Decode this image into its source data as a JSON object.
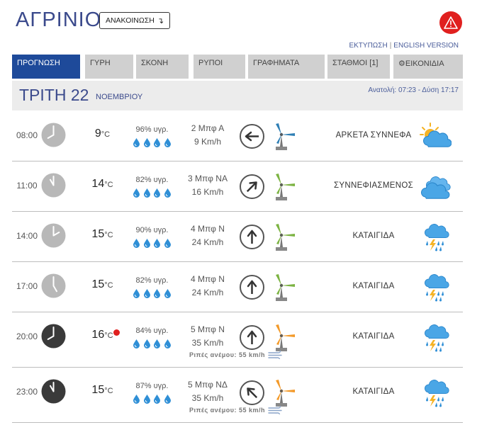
{
  "header": {
    "city": "ΑΓΡΙΝΙΟ",
    "announce_label": "ΑΝΑΚΟΙΝΩΣΗ",
    "announce_arrow": "↴",
    "print_link": "ΕΚΤΥΠΩΣΗ",
    "link_sep": "|",
    "english_link": "ENGLISH VERSION"
  },
  "tabs": [
    {
      "label": "ΠΡΟΓΝΩΣΗ",
      "active": true
    },
    {
      "label": "ΓΥΡΗ"
    },
    {
      "label": "ΣΚΟΝΗ"
    },
    {
      "label": "ΡΥΠΟΙ"
    },
    {
      "label": "ΓΡΑΦΗΜΑΤΑ"
    },
    {
      "label": "ΣΤΑΘΜΟΙ [1]"
    },
    {
      "label": "⚙ΕΙΚΟΝΙΔΙΑ",
      "icon": "gear-icon"
    }
  ],
  "day": {
    "name": "ΤΡΙΤΗ 22",
    "month": "ΝΟΕΜΒΡΙΟΥ",
    "sun": "Ανατολή: 07:23 - Δύση 17:17"
  },
  "unit_c": "°C",
  "colors": {
    "accent": "#3b4a8c",
    "active_tab": "#1e4a9a",
    "alert": "#e0201f",
    "turbine_low": "#2f7fb5",
    "turbine_mid": "#7cb342",
    "turbine_high": "#f39a2a"
  },
  "rows": [
    {
      "time": "08:00",
      "clock": "day",
      "temp": "9",
      "humidity": "96% υγρ.",
      "wind_bf": "2 Μπφ Α",
      "wind_kmh": "9 Km/h",
      "wind_dir": "E",
      "turbine": "low",
      "condition": "ΑΡΚΕΤΑ ΣΥΝΝΕΦΑ",
      "icon": "partly-cloudy-icon"
    },
    {
      "time": "11:00",
      "clock": "day",
      "temp": "14",
      "humidity": "82% υγρ.",
      "wind_bf": "3 Μπφ ΝΑ",
      "wind_kmh": "16 Km/h",
      "wind_dir": "SE",
      "turbine": "mid",
      "condition": "ΣΥΝΝΕΦΙΑΣΜΕΝΟΣ",
      "icon": "cloudy-icon"
    },
    {
      "time": "14:00",
      "clock": "day",
      "temp": "15",
      "humidity": "90% υγρ.",
      "wind_bf": "4 Μπφ Ν",
      "wind_kmh": "24 Km/h",
      "wind_dir": "S",
      "turbine": "mid",
      "condition": "ΚΑΤΑΙΓΙΔΑ",
      "icon": "thunderstorm-icon"
    },
    {
      "time": "17:00",
      "clock": "day",
      "temp": "15",
      "humidity": "82% υγρ.",
      "wind_bf": "4 Μπφ Ν",
      "wind_kmh": "24 Km/h",
      "wind_dir": "S",
      "turbine": "mid",
      "condition": "ΚΑΤΑΙΓΙΔΑ",
      "icon": "thunderstorm-icon"
    },
    {
      "time": "20:00",
      "clock": "night",
      "temp": "16",
      "humidity": "84% υγρ.",
      "wind_bf": "5 Μπφ Ν",
      "wind_kmh": "35 Km/h",
      "wind_dir": "S",
      "turbine": "high",
      "condition": "ΚΑΤΑΙΓΙΔΑ",
      "icon": "thunderstorm-icon",
      "gust": "Ριπές ανέμου: 55 km/h",
      "alert": true
    },
    {
      "time": "23:00",
      "clock": "night",
      "temp": "15",
      "humidity": "87% υγρ.",
      "wind_bf": "5 Μπφ ΝΔ",
      "wind_kmh": "35 Km/h",
      "wind_dir": "SW",
      "turbine": "high",
      "condition": "ΚΑΤΑΙΓΙΔΑ",
      "icon": "thunderstorm-icon",
      "gust": "Ριπές ανέμου: 55 km/h"
    }
  ]
}
